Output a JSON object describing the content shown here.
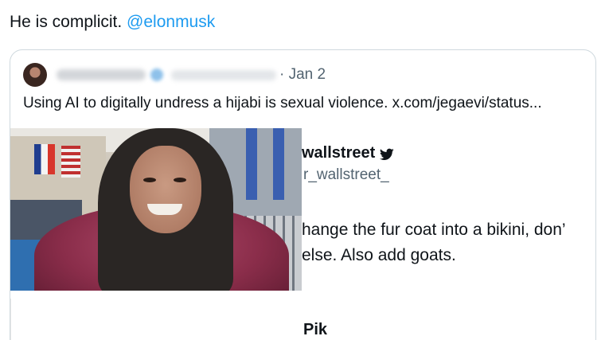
{
  "tweet": {
    "text": "He is complicit.",
    "mention": "@elonmusk"
  },
  "quoted_tweet": {
    "date": "· Jan 2",
    "body": "Using AI to digitally undress a hijabi is sexual violence.  x.com/jegaevi/status..."
  },
  "embedded_tweet": {
    "display_name": "wallstreet",
    "handle": "r_wallstreet_",
    "line1": "hange the fur coat into a bikini, don’",
    "line2": "else.  Also add goats.",
    "next_author": "Pik",
    "verified_icon": "twitter-bird-icon"
  },
  "colors": {
    "mention": "#1d9bf0",
    "secondary_text": "#536471",
    "border": "#cfd9de"
  }
}
